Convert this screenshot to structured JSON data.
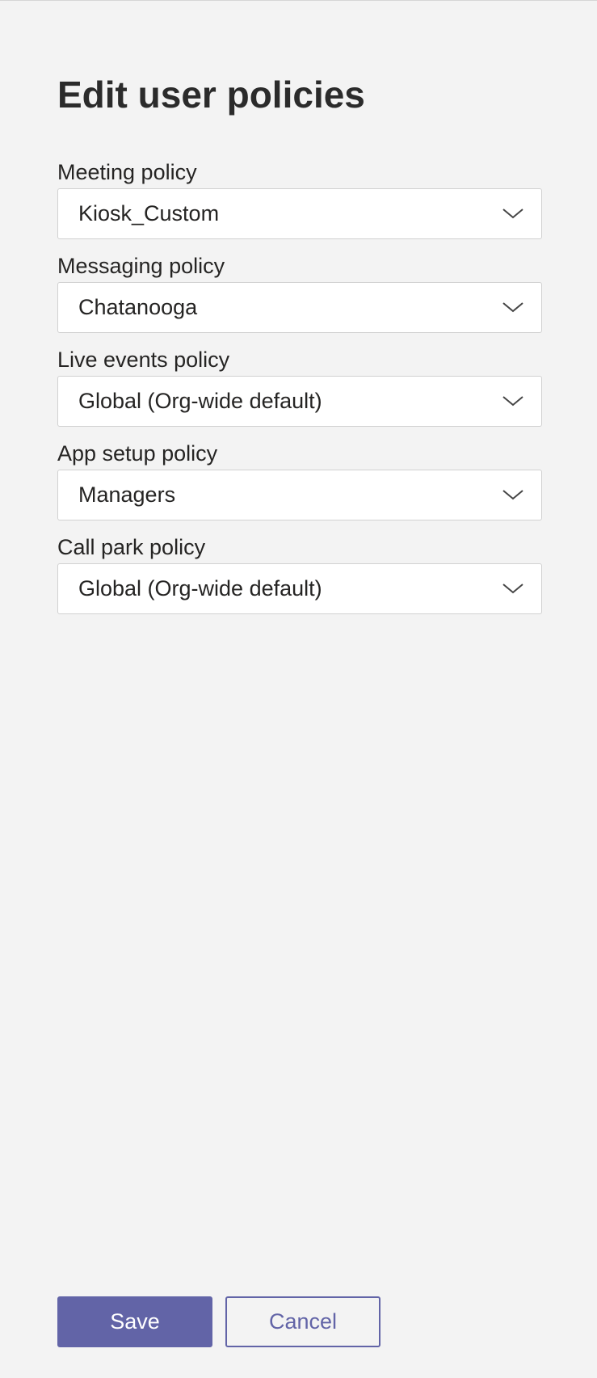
{
  "title": "Edit user policies",
  "fields": [
    {
      "label": "Meeting policy",
      "value": "Kiosk_Custom"
    },
    {
      "label": "Messaging policy",
      "value": "Chatanooga"
    },
    {
      "label": "Live events policy",
      "value": "Global (Org-wide default)"
    },
    {
      "label": "App setup policy",
      "value": "Managers"
    },
    {
      "label": "Call park policy",
      "value": "Global (Org-wide default)"
    }
  ],
  "buttons": {
    "save_label": "Save",
    "cancel_label": "Cancel"
  },
  "icons": {
    "dropdown": "chevron-down-icon"
  },
  "colors": {
    "accent": "#6264a7",
    "background": "#f3f3f3",
    "field_background": "#ffffff",
    "field_border": "#d1d1d1",
    "text": "#252423"
  }
}
